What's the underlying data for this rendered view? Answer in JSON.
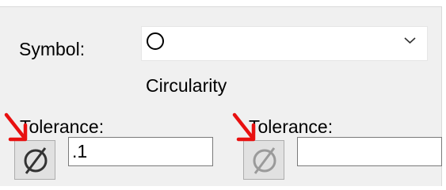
{
  "symbol": {
    "label": "Symbol:",
    "selected_icon": "circle-icon",
    "dropdown_icon": "chevron-down-icon",
    "description": "Circularity"
  },
  "tolerance_1": {
    "label": "Tolerance:",
    "diameter_icon": "diameter-icon",
    "diameter_state": "enabled",
    "value": ".1"
  },
  "tolerance_2": {
    "label": "Tolerance:",
    "diameter_icon": "diameter-icon",
    "diameter_state": "disabled",
    "value": ""
  },
  "colors": {
    "panel_background": "#f0f0f0",
    "annotation_arrow": "#e81010",
    "diameter_enabled": "#333333",
    "diameter_disabled": "#9a9a9a"
  }
}
